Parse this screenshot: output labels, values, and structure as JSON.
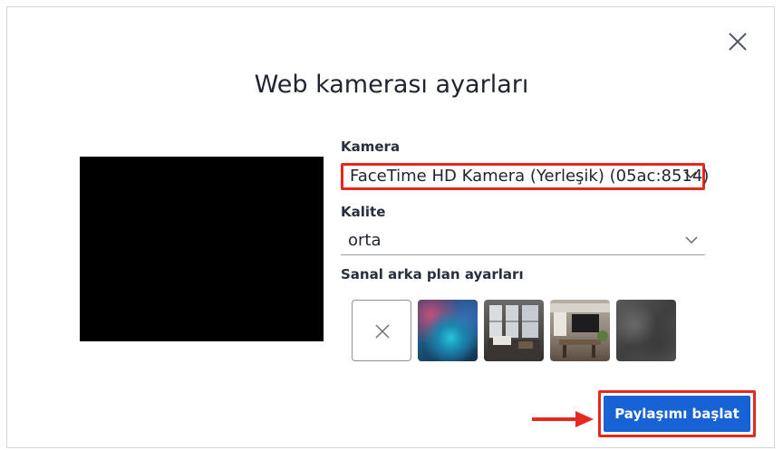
{
  "dialog": {
    "title": "Web kamerası ayarları",
    "close_icon": "close-icon"
  },
  "camera": {
    "label": "Kamera",
    "value": "FaceTime HD Kamera (Yerleşik) (05ac:8514)"
  },
  "quality": {
    "label": "Kalite",
    "value": "orta"
  },
  "virtual_background": {
    "label": "Sanal arka plan ayarları",
    "options": [
      "none",
      "blur",
      "room-1",
      "room-2",
      "stone"
    ]
  },
  "actions": {
    "start_label": "Paylaşımı başlat"
  },
  "colors": {
    "highlight": "#e6281e",
    "primary": "#1763d6"
  }
}
